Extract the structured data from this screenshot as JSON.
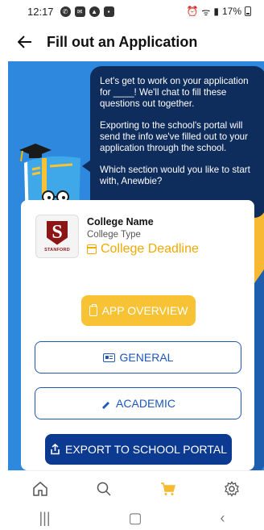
{
  "status_bar": {
    "time": "12:17",
    "battery": "17%"
  },
  "header": {
    "title": "Fill out an Application"
  },
  "chat": {
    "p1": "Let's get to work on your application for ____! We'll chat to fill these questions out together.",
    "p2": "Exporting to the school's portal will send the info we've filled out to your application through the school.",
    "p3": "Which section would you like to start with, Anewbie?"
  },
  "college": {
    "logo_letter": "S",
    "logo_text": "STANFORD",
    "name": "College Name",
    "type": "College Type",
    "deadline": "College Deadline"
  },
  "buttons": {
    "overview": "APP OVERVIEW",
    "general": "GENERAL",
    "academic": "ACADEMIC",
    "export": "EXPORT TO SCHOOL PORTAL"
  },
  "colors": {
    "primary_blue": "#2d88de",
    "dark_navy": "#0e2c5c",
    "accent_yellow": "#f7c335",
    "button_blue": "#1f57b8",
    "export_blue": "#0d3a91"
  }
}
